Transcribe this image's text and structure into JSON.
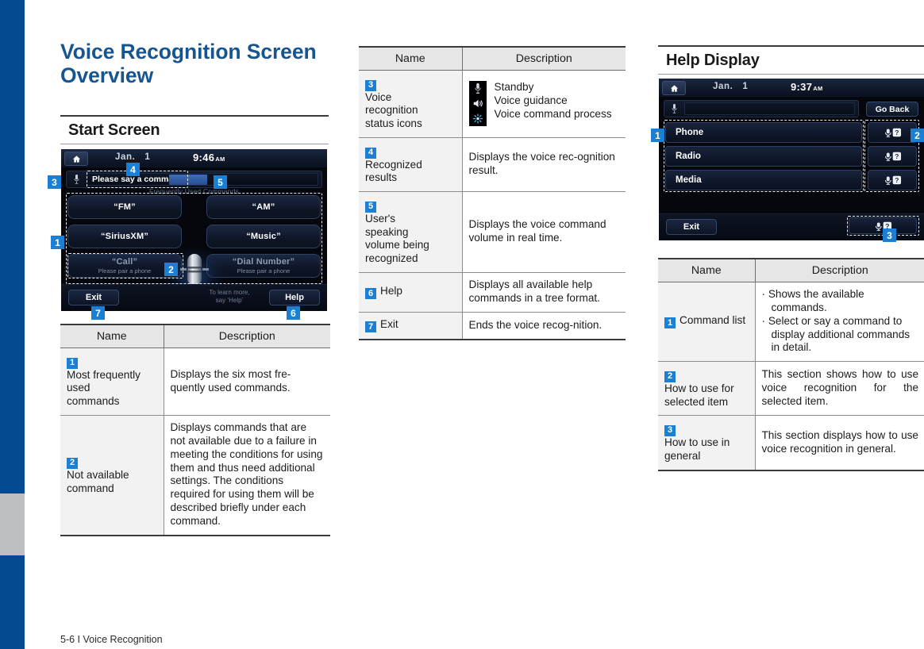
{
  "page": {
    "title_line1": "Voice Recognition Screen",
    "title_line2": "Overview",
    "footer": "5-6 I Voice Recognition",
    "accent_blue": "#034a91",
    "badge_blue": "#1b7fd4",
    "heading_blue": "#17558f"
  },
  "sections": {
    "start_screen": "Start Screen",
    "help_display": "Help Display"
  },
  "start_device": {
    "home_icon": "home-icon",
    "date_month": "Jan.",
    "date_day": "1",
    "time": "9:46",
    "ampm": "AM",
    "mic_icon": "microphone-icon",
    "command_prompt": "Please say a command.",
    "frequently_used_label": "Frequently Used Commands",
    "commands": [
      {
        "label": "“FM”",
        "sub": "",
        "dim": false
      },
      {
        "label": "“AM”",
        "sub": "",
        "dim": false
      },
      {
        "label": "“SiriusXM”",
        "sub": "",
        "dim": false
      },
      {
        "label": "“Music”",
        "sub": "",
        "dim": false
      },
      {
        "label": "“Call”",
        "sub": "Please pair a phone",
        "dim": true
      },
      {
        "label": "“Dial Number”",
        "sub": "Please pair a phone",
        "dim": true
      }
    ],
    "exit_label": "Exit",
    "help_label": "Help",
    "learn_more_line1": "To learn more,",
    "learn_more_line2": "say ‘Help’",
    "callouts": [
      "1",
      "2",
      "3",
      "4",
      "5",
      "6",
      "7"
    ]
  },
  "help_device": {
    "home_icon": "home-icon",
    "date_month": "Jan.",
    "date_day": "1",
    "time": "9:37",
    "ampm": "AM",
    "mic_icon": "microphone-icon",
    "go_back_label": "Go Back",
    "rows": [
      "Phone",
      "Radio",
      "Media"
    ],
    "row_icon": "mic-question-icon",
    "exit_label": "Exit",
    "general_help_icon": "mic-question-icon",
    "callouts": [
      "1",
      "2",
      "3"
    ]
  },
  "table_left": {
    "headers": {
      "name": "Name",
      "description": "Description"
    },
    "rows": [
      {
        "num": "1",
        "name": "Most frequently used commands",
        "desc": "Displays the six most fre-quently used commands."
      },
      {
        "num": "2",
        "name": "Not available command",
        "desc": "Displays commands that are not available due to a failure in meeting the conditions for using them and thus need additional settings. The conditions required for using them will be described briefly under each command."
      }
    ]
  },
  "table_mid": {
    "headers": {
      "name": "Name",
      "description": "Description"
    },
    "rows": [
      {
        "num": "3",
        "name": "Voice recognition status icons",
        "desc_items": [
          {
            "icon": "microphone-icon",
            "text": "Standby"
          },
          {
            "icon": "speaker-icon",
            "text": "Voice guidance"
          },
          {
            "icon": "processing-spinner-icon",
            "text": "Voice command process"
          }
        ]
      },
      {
        "num": "4",
        "name": "Recognized results",
        "desc": "Displays the voice rec-ognition result."
      },
      {
        "num": "5",
        "name": "User's speaking volume being recognized",
        "desc": "Displays the voice command volume in real time."
      },
      {
        "num": "6",
        "name": "Help",
        "desc": "Displays all available help commands in a tree format."
      },
      {
        "num": "7",
        "name": "Exit",
        "desc": "Ends the voice recog-nition."
      }
    ]
  },
  "table_right": {
    "headers": {
      "name": "Name",
      "description": "Description"
    },
    "rows": [
      {
        "num": "1",
        "name": "Command list",
        "bullets": [
          "Shows the available commands.",
          "Select or say a command to display additional commands in detail."
        ]
      },
      {
        "num": "2",
        "name": "How to use for selected item",
        "desc": "This section shows how to use voice recognition for the selected item."
      },
      {
        "num": "3",
        "name": "How to use in general",
        "desc": "This section displays how to use voice recognition in general."
      }
    ]
  }
}
